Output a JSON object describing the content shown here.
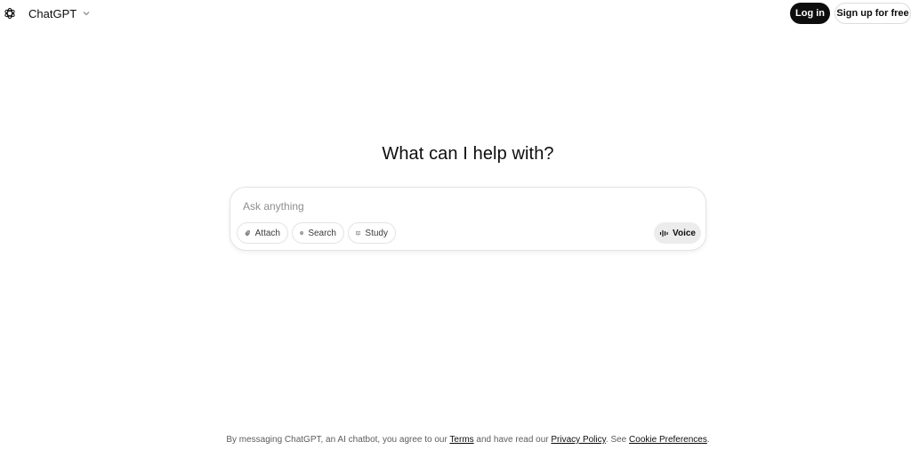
{
  "header": {
    "brand_name": "ChatGPT",
    "login_label": "Log in",
    "signup_label": "Sign up for free"
  },
  "main": {
    "headline": "What can I help with?",
    "composer": {
      "placeholder": "Ask anything",
      "value": "",
      "tools": {
        "attach_label": "Attach",
        "search_label": "Search",
        "study_label": "Study"
      },
      "voice_label": "Voice"
    }
  },
  "footer": {
    "prefix": "By messaging ChatGPT, an AI chatbot, you agree to our ",
    "terms_label": "Terms",
    "middle": " and have read our ",
    "privacy_label": "Privacy Policy",
    "see": ". See ",
    "cookie_label": "Cookie Preferences",
    "suffix": "."
  },
  "icons": {
    "logo": "openai-logo-icon",
    "brand_menu": "chevron-down-icon",
    "attach": "paperclip-icon",
    "search": "globe-icon",
    "study": "book-icon",
    "voice": "waveform-icon"
  },
  "colors": {
    "primary_button": "#0d0d0d",
    "primary_button_text": "#ffffff",
    "border": "#e3e3e3",
    "voice_button_bg": "#ececec",
    "placeholder_text": "#8f8f8f"
  }
}
